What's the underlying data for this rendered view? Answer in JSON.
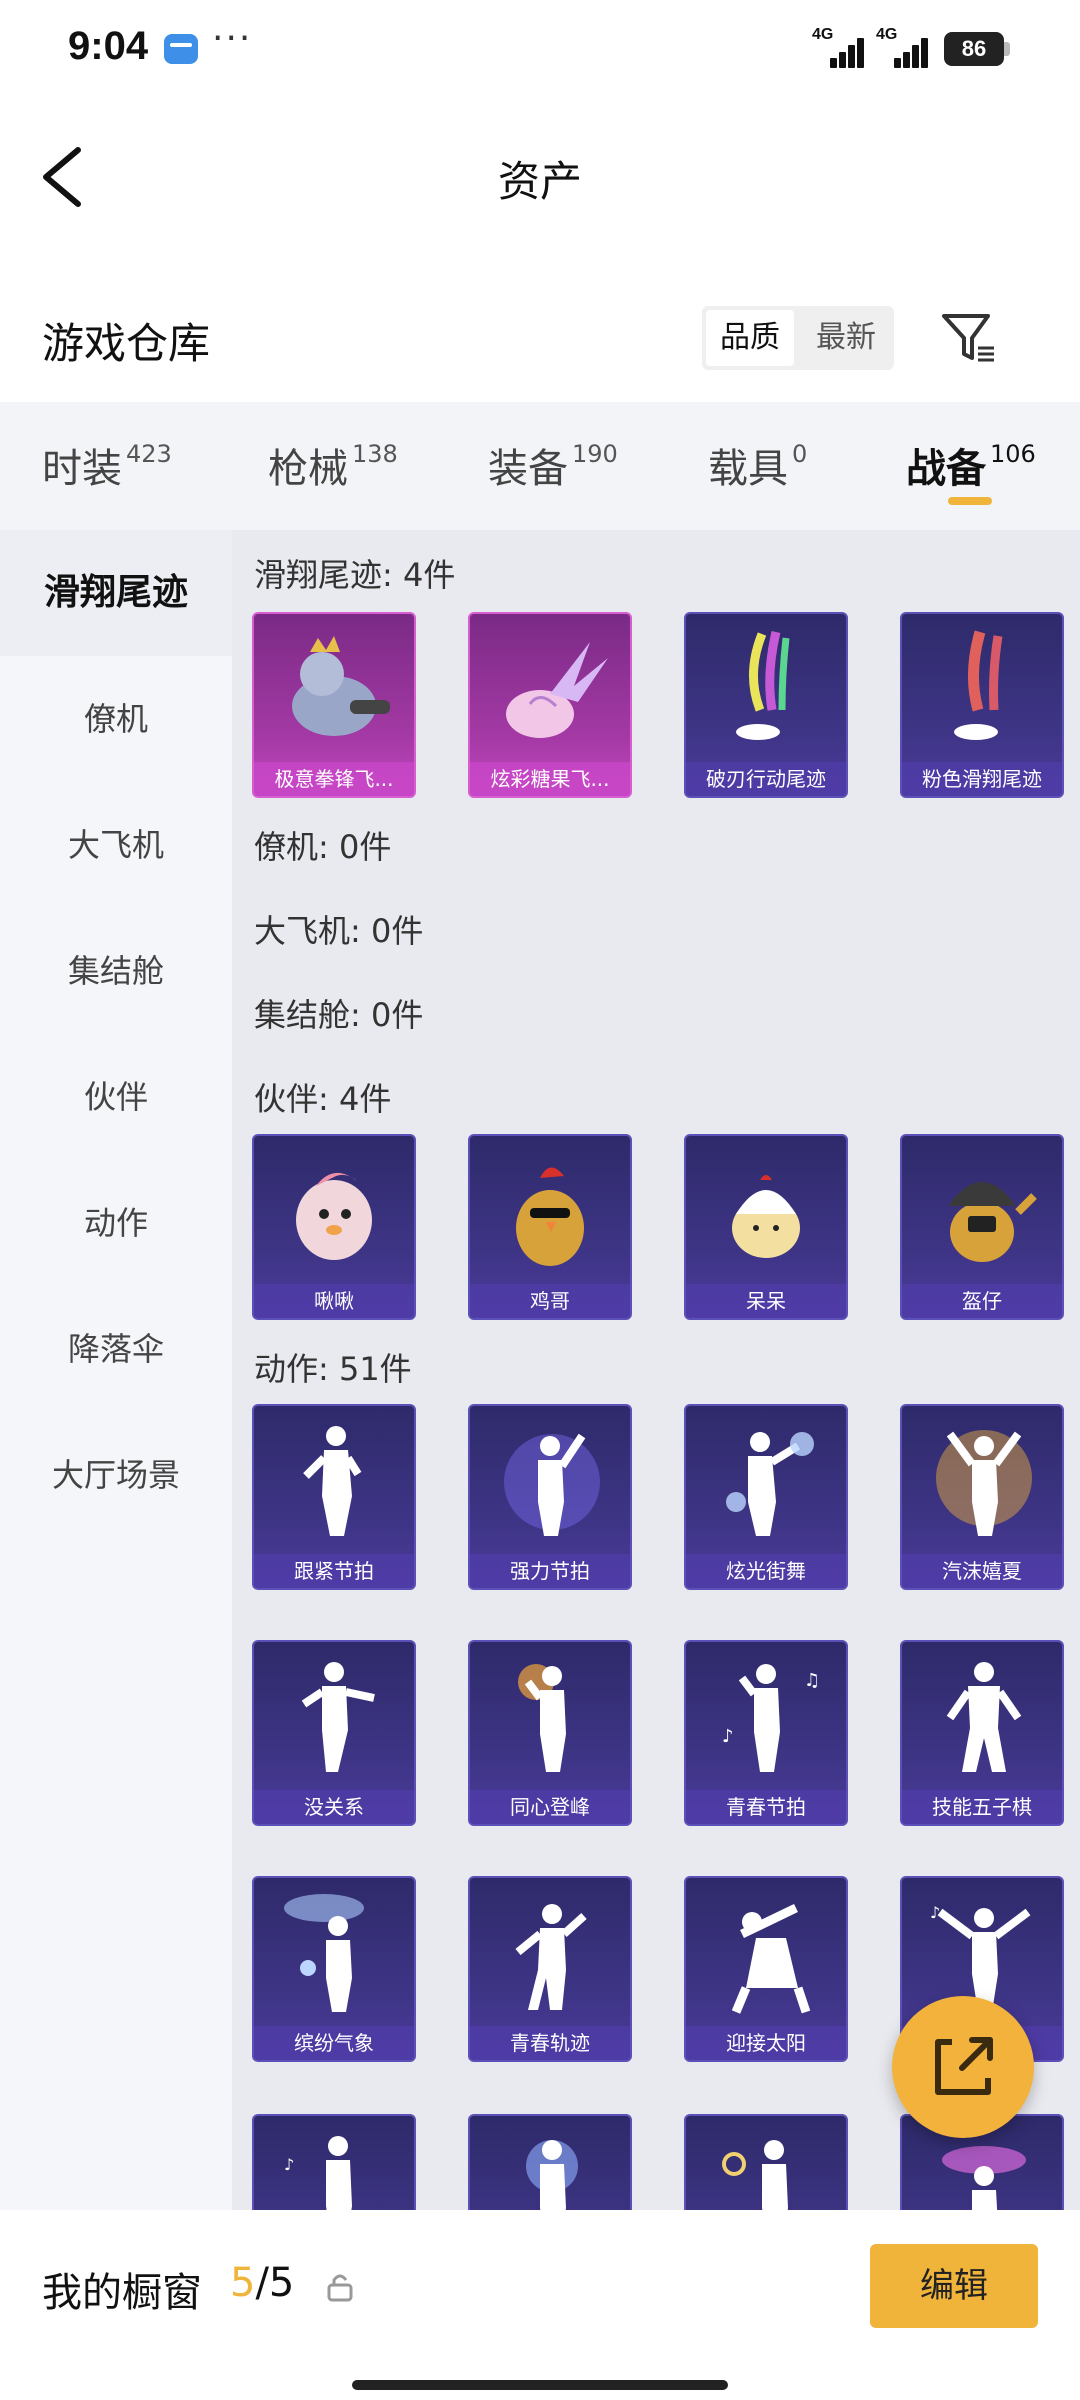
{
  "status_bar": {
    "time": "9:04",
    "dots": "···",
    "signal_1": "4G",
    "signal_2": "4G",
    "battery": "86"
  },
  "header": {
    "title": "资产"
  },
  "section": {
    "title": "游戏仓库",
    "sort_options": [
      "品质",
      "最新"
    ],
    "sort_selected": "品质"
  },
  "tabs": [
    {
      "label": "时装",
      "count": "423"
    },
    {
      "label": "枪械",
      "count": "138"
    },
    {
      "label": "装备",
      "count": "190"
    },
    {
      "label": "载具",
      "count": "0"
    },
    {
      "label": "战备",
      "count": "106",
      "active": true
    }
  ],
  "sidebar": {
    "items": [
      "滑翔尾迹",
      "僚机",
      "大飞机",
      "集结舱",
      "伙伴",
      "动作",
      "降落伞",
      "大厅场景"
    ],
    "active": "滑翔尾迹"
  },
  "groups": [
    {
      "label": "滑翔尾迹: 4件",
      "items": [
        "极意拳锋飞...",
        "炫彩糖果飞...",
        "破刃行动尾迹",
        "粉色滑翔尾迹"
      ]
    },
    {
      "label": "僚机: 0件",
      "items": []
    },
    {
      "label": "大飞机: 0件",
      "items": []
    },
    {
      "label": "集结舱: 0件",
      "items": []
    },
    {
      "label": "伙伴: 4件",
      "items": [
        "啾啾",
        "鸡哥",
        "呆呆",
        "盔仔"
      ]
    },
    {
      "label": "动作: 51件",
      "items": [
        "跟紧节拍",
        "强力节拍",
        "炫光街舞",
        "汽沫嬉夏",
        "没关系",
        "同心登峰",
        "青春节拍",
        "技能五子棋",
        "缤纷气象",
        "青春轨迹",
        "迎接太阳",
        ""
      ]
    }
  ],
  "bottom": {
    "title": "我的橱窗",
    "count_current": "5",
    "count_total": "/5",
    "edit_label": "编辑"
  },
  "colors": {
    "accent": "#f0b43a",
    "card_purple": "#3d3484",
    "card_pink": "#a63aa6"
  }
}
